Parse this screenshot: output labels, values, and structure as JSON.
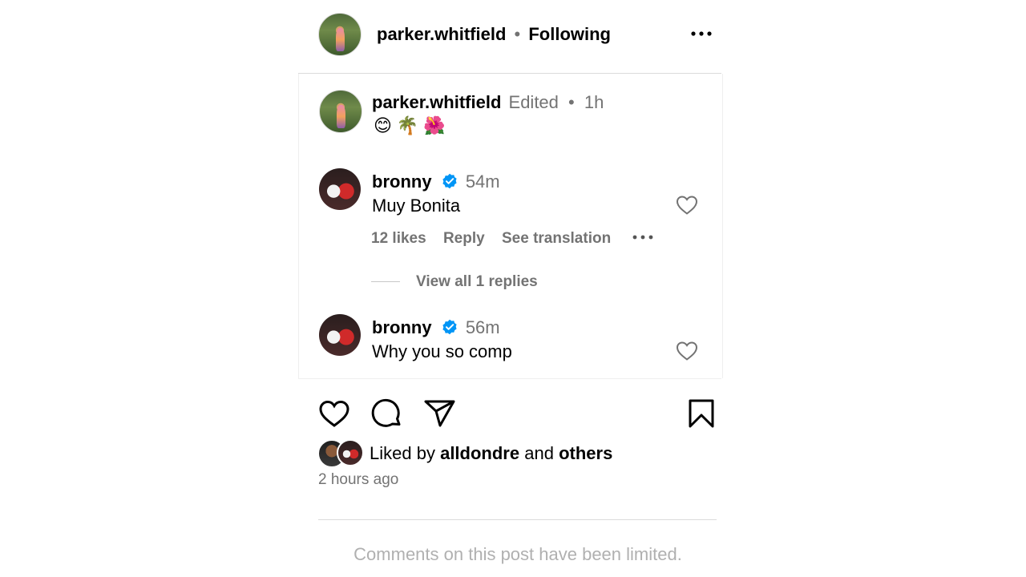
{
  "header": {
    "username": "parker.whitfield",
    "separator": "•",
    "follow_status": "Following",
    "more_icon": "more-horizontal-icon"
  },
  "caption": {
    "username": "parker.whitfield",
    "edited": "Edited",
    "separator": "•",
    "time": "1h",
    "text": "😊🌴🌺"
  },
  "comments": [
    {
      "username": "bronny",
      "time": "54m",
      "text": "Muy Bonita",
      "likes": "12 likes",
      "reply_label": "Reply",
      "translate_label": "See translation",
      "view_replies": "View all 1 replies"
    },
    {
      "username": "bronny",
      "time": "56m",
      "text": "Why you so comp"
    }
  ],
  "actions": {
    "like_icon": "heart-icon",
    "comment_icon": "comment-icon",
    "share_icon": "send-icon",
    "save_icon": "bookmark-icon"
  },
  "likes": {
    "prefix": "Liked by",
    "user": "alldondre",
    "conjunction": "and",
    "others": "others"
  },
  "timestamp": "2 hours ago",
  "footer": {
    "limited_notice": "Comments on this post have been limited."
  },
  "colors": {
    "verified": "#0095f6",
    "muted": "#737373",
    "divider": "#dbdbdb"
  }
}
